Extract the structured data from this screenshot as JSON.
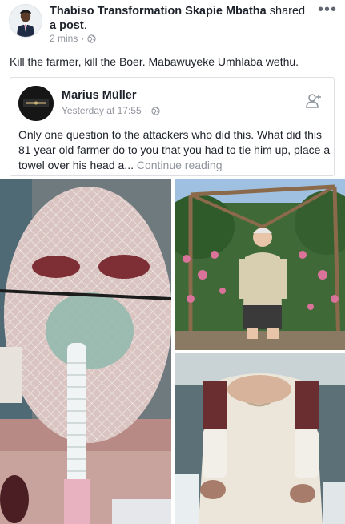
{
  "post": {
    "author_name": "Thabiso Transformation Skapie Mbatha",
    "action_verb": "shared",
    "action_object": "a post",
    "timestamp": "2 mins",
    "separator": "·",
    "privacy_icon": "globe-icon",
    "more_icon": "more-options-icon",
    "more_glyph": "•••",
    "status_text": "Kill the farmer,  kill the Boer. Mabawuyeke Umhlaba wethu."
  },
  "shared_post": {
    "author_name": "Marius Müller",
    "timestamp": "Yesterday at 17:55",
    "separator": "·",
    "privacy_icon": "globe-icon",
    "add_friend_icon": "add-friend-icon",
    "text": "Only one question to the attackers who did this. What did this 81 year old farmer do to you that you had to tie him up, place a towel over his head a...",
    "continue_label": "Continue reading"
  },
  "photos": [
    {
      "name": "injured-face-photo"
    },
    {
      "name": "farmer-garden-photo"
    },
    {
      "name": "bandaged-body-photo"
    }
  ],
  "colors": {
    "text": "#1d2129",
    "meta_gray": "#90949c",
    "border": "#dddfe2",
    "background": "#ffffff"
  }
}
